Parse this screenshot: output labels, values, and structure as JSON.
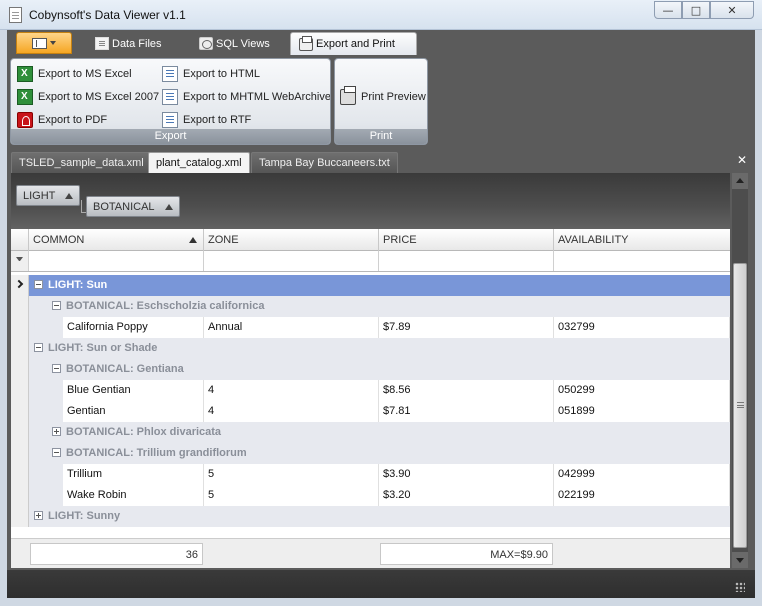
{
  "window": {
    "title": "Cobynsoft's Data Viewer v1.1",
    "minimize_glyph": "—",
    "maximize_glyph": "□",
    "close_glyph": "✕"
  },
  "ribbon": {
    "tabs": [
      {
        "label": "Data Files"
      },
      {
        "label": "SQL Views"
      },
      {
        "label": "Export and Print",
        "active": true
      }
    ],
    "groups": {
      "export": {
        "label": "Export",
        "buttons": [
          {
            "label": "Export to MS Excel",
            "icon": "excel-icon"
          },
          {
            "label": "Export to MS Excel 2007",
            "icon": "excel-icon"
          },
          {
            "label": "Export to PDF",
            "icon": "pdf-icon"
          },
          {
            "label": "Export to HTML",
            "icon": "document-icon"
          },
          {
            "label": "Export to MHTML WebArchive",
            "icon": "document-icon"
          },
          {
            "label": "Export to RTF",
            "icon": "document-icon"
          }
        ]
      },
      "print": {
        "label": "Print",
        "buttons": [
          {
            "label": "Print Preview",
            "icon": "printer-icon"
          }
        ]
      }
    }
  },
  "doc_tabs": {
    "tabs": [
      {
        "label": "TSLED_sample_data.xml"
      },
      {
        "label": "plant_catalog.xml",
        "active": true
      },
      {
        "label": "Tampa Bay Buccaneers.txt"
      }
    ],
    "close_glyph": "✕"
  },
  "grid": {
    "group_by": [
      "LIGHT",
      "BOTANICAL"
    ],
    "columns": [
      "COMMON",
      "ZONE",
      "PRICE",
      "AVAILABILITY"
    ],
    "sorted_column": "COMMON",
    "rows": [
      {
        "kind": "group1",
        "text": "LIGHT: Sun",
        "expanded": true,
        "selected": true
      },
      {
        "kind": "group2",
        "text": "BOTANICAL: Eschscholzia californica",
        "expanded": true
      },
      {
        "kind": "data",
        "cells": [
          "California Poppy",
          "Annual",
          "$7.89",
          "032799"
        ]
      },
      {
        "kind": "group1",
        "text": "LIGHT: Sun or Shade",
        "expanded": true
      },
      {
        "kind": "group2",
        "text": "BOTANICAL: Gentiana",
        "expanded": true
      },
      {
        "kind": "data",
        "cells": [
          "Blue Gentian",
          "4",
          "$8.56",
          "050299"
        ]
      },
      {
        "kind": "data",
        "cells": [
          "Gentian",
          "4",
          "$7.81",
          "051899"
        ]
      },
      {
        "kind": "group2",
        "text": "BOTANICAL: Phlox divaricata",
        "expanded": false
      },
      {
        "kind": "group2",
        "text": "BOTANICAL: Trillium grandiflorum",
        "expanded": true
      },
      {
        "kind": "data",
        "cells": [
          "Trillium",
          "5",
          "$3.90",
          "042999"
        ]
      },
      {
        "kind": "data",
        "cells": [
          "Wake Robin",
          "5",
          "$3.20",
          "022199"
        ]
      },
      {
        "kind": "group1",
        "text": "LIGHT: Sunny",
        "expanded": false
      }
    ],
    "footer": {
      "count": "36",
      "price_summary": "MAX=$9.90"
    }
  },
  "colors": {
    "selected_group_row": "#7996d8",
    "group_row": "#e7e9ef",
    "chrome_dark": "#5b5b5b",
    "app_menu_orange": "#f5a623"
  }
}
